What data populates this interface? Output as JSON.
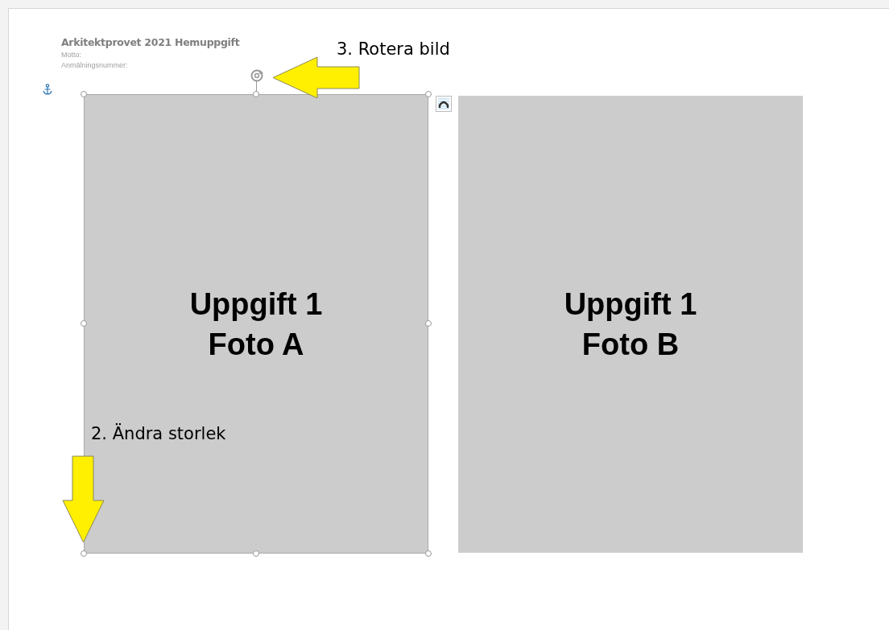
{
  "document": {
    "title": "Arkitektprovet 2021 Hemuppgift",
    "fields": [
      "Motto:",
      "Anmälningsnummer:"
    ]
  },
  "images": [
    {
      "caption": [
        "Uppgift 1",
        "Foto A"
      ],
      "selected": true
    },
    {
      "caption": [
        "Uppgift 1",
        "Foto B"
      ],
      "selected": false
    }
  ],
  "annotations": [
    {
      "kind": "left-arrow",
      "label": "3. Rotera bild"
    },
    {
      "kind": "down-arrow",
      "label": "2. Ändra storlek"
    }
  ]
}
